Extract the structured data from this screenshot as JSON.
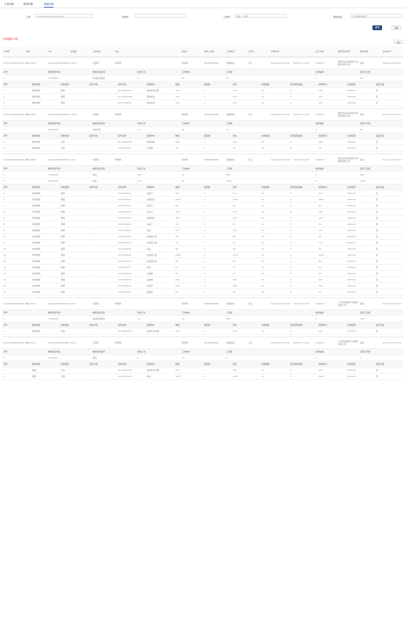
{
  "tabs": [
    {
      "label": "工单对账"
    },
    {
      "label": "费用对账"
    },
    {
      "label": "明细对账"
    }
  ],
  "filters": {
    "order_no_label": "工单",
    "order_no_value": "L20200801511020000003",
    "plate_label": "车牌号",
    "plate_value": "",
    "phone_label": "工单号",
    "phone_placeholder": "请输入工单号",
    "store_label": "服务网点",
    "store_placeholder": "请选择服务网点"
  },
  "buttons": {
    "search": "查询",
    "reset": "重置",
    "export": "导出"
  },
  "summary_text": "共有数据155条",
  "order_columns": [
    "工单号",
    "车牌",
    "VIN",
    "总里程",
    "工单状态",
    "车主",
    "",
    "",
    "送修人",
    "送修人电话",
    "工单来源",
    "接单人",
    "开单时间",
    "",
    "完工时间",
    "服务网点名称",
    "服务类型",
    "交车时间"
  ],
  "orders": [
    {
      "cells": [
        "R2110300001P0000",
        "豫A12345",
        "LSVAN4187N2000001",
        "15327",
        "已结算",
        "李师傅",
        "",
        "",
        "李师傅",
        "18569758888",
        "微信预约",
        "张三",
        "2021/10/30 23:06",
        "2022/1/7 12:00",
        "2022/1/7",
        "重庆市渝北区顺德汽车服务有限公司",
        "保养",
        "2022-01-07 09:51"
      ],
      "ticket_header": [
        "序号",
        "维修项目代码",
        "维修项目名称",
        "标准工时",
        "工时单价",
        "工时费",
        "",
        "优惠金额",
        "实际工时费"
      ],
      "tickets": [
        [
          "1",
          "71063000",
          "机油机滤更换",
          "6",
          "60",
          "90",
          "",
          "0",
          "90"
        ]
      ],
      "parts_header": [
        "序号",
        "维修类型",
        "收费类型",
        "配件代码",
        "配件名称",
        "结算单价",
        "数量",
        "结算额",
        "折扣",
        "优惠金额",
        "实际结算金额",
        "结算时间",
        "出库结算",
        "是否已结"
      ],
      "parts": [
        [
          "1",
          "保养维修",
          "质保",
          "-",
          "JP-L20200731",
          "发动机滤清器",
          "120",
          "1",
          "120",
          "10",
          "0",
          "120",
          "2022/01",
          "否"
        ],
        [
          "2",
          "保养维修",
          "质保",
          "-",
          "JP-L20201202",
          "发动机油",
          "120",
          "1",
          "120",
          "10",
          "0",
          "120",
          "2022/01",
          "否"
        ],
        [
          "3",
          "保养维修",
          "质保",
          "-",
          "S317230203",
          "机滤总成",
          "170",
          "1",
          "170",
          "10",
          "0",
          "170",
          "2022/01",
          "否"
        ]
      ]
    },
    {
      "cells": [
        "R2112190003P0000",
        "豫A67890",
        "LSVAN4187N2000002",
        "11000",
        "已结算",
        "李师傅",
        "",
        "",
        "李师傅",
        "18569758888",
        "微信预约",
        "张三",
        "2021/12/19 13:06",
        "2022/1/7 12:00",
        "2022/1/7",
        "重庆市渝北区顺德汽车服务有限公司",
        "保养",
        "2022-01-07 09:52"
      ],
      "ticket_header": [
        "序号",
        "维修项目代码",
        "维修项目名称",
        "标准工时",
        "工时单价",
        "工时费",
        "",
        "优惠金额",
        "实际工时费"
      ],
      "tickets": [
        [
          "1",
          "00000000",
          "全车检查",
          "0.7",
          "60",
          "60",
          "",
          "0",
          "60"
        ]
      ],
      "parts_header": [
        "序号",
        "维修类型",
        "收费类型",
        "配件代码",
        "配件名称",
        "结算单价",
        "数量",
        "结算额",
        "折扣",
        "优惠金额",
        "实际结算金额",
        "结算时间",
        "出库结算",
        "是否已结"
      ],
      "parts": [
        [
          "1",
          "保养维修",
          "正常",
          "-",
          "JP-L20200730",
          "前制动盘",
          "298",
          "1",
          "218",
          "10",
          "0",
          "218",
          "2022/01",
          "否"
        ],
        [
          "2",
          "保养维修",
          "正常",
          "-",
          "S317230212",
          "冷凝器",
          "26",
          "1",
          "18",
          "10",
          "0",
          "18",
          "2022/01",
          "否"
        ]
      ]
    },
    {
      "cells": [
        "R2110290001P0000",
        "豫A24680",
        "LSVAN4187N2000003",
        "3123",
        "已结算",
        "李师傅",
        "",
        "",
        "李师傅",
        "18569758888",
        "微信预约",
        "张三",
        "2021/10/29 23:06",
        "2022/1/7 12:00",
        "2022/1/7",
        "重庆市渝北区顺德汽车服务有限公司",
        "保养",
        "2021-10-29 10:10"
      ],
      "ticket_header": [
        "序号",
        "维修项目代码",
        "维修项目名称",
        "标准工时",
        "工时单价",
        "工时费",
        "",
        "优惠金额",
        "实际工时费"
      ],
      "tickets": [
        [
          "1",
          "71063000",
          "喷漆",
          "14.5",
          "60",
          "800",
          "",
          "0",
          "800"
        ],
        [
          "2",
          "24560000",
          "钣金",
          "21.7",
          "60",
          "1300",
          "",
          "0",
          "1300"
        ]
      ],
      "parts_header": [
        "序号",
        "维修类型",
        "收费类型",
        "配件代码",
        "配件名称",
        "结算单价",
        "数量",
        "结算额",
        "折扣",
        "优惠金额",
        "实际结算金额",
        "结算时间",
        "出库结算",
        "是否已结"
      ],
      "parts": [
        [
          "1",
          "喷漆维修",
          "质保",
          "-",
          "S317230215",
          "右前门",
          "117",
          "1",
          "117",
          "10",
          "0",
          "117",
          "2021/10",
          "否"
        ],
        [
          "2",
          "喷漆维修",
          "质保",
          "-",
          "S317230216",
          "后保险杠",
          "2000",
          "1",
          "2000",
          "10",
          "0",
          "2000",
          "2021/10",
          "否"
        ],
        [
          "3",
          "喷漆维修",
          "质保",
          "-",
          "S317230217",
          "左前门",
          "84",
          "1",
          "84",
          "10",
          "0",
          "84",
          "2021/10",
          "否"
        ],
        [
          "4",
          "喷漆维修",
          "质保",
          "-",
          "S317230218",
          "左后门",
          "130",
          "1",
          "130",
          "10",
          "0",
          "130",
          "2021/10",
          "否"
        ],
        [
          "5",
          "喷漆维修",
          "质保",
          "-",
          "S317230219",
          "前保险杠",
          "125",
          "1",
          "125",
          "10",
          "0",
          "125",
          "2021/10",
          "否"
        ],
        [
          "6",
          "喷漆维修",
          "质保",
          "-",
          "S317230220",
          "右后门",
          "79",
          "1",
          "79",
          "10",
          "0",
          "79",
          "2021/10",
          "否"
        ],
        [
          "7",
          "喷漆维修",
          "质保",
          "-",
          "S317230221",
          "机盖",
          "172",
          "1",
          "172",
          "10",
          "0",
          "172",
          "2021/10",
          "否"
        ],
        [
          "8",
          "喷漆维修",
          "质保",
          "-",
          "S317230222",
          "左前翼子板",
          "96",
          "1",
          "96",
          "10",
          "0",
          "96",
          "2021/10",
          "否"
        ],
        [
          "9",
          "喷漆维修",
          "质保",
          "-",
          "S317230223",
          "右前翼子板",
          "74",
          "1",
          "74",
          "10",
          "0",
          "74",
          "2021/10",
          "否"
        ],
        [
          "10",
          "喷漆维修",
          "质保",
          "-",
          "S317230224",
          "后盖",
          "99",
          "1",
          "99",
          "10",
          "0",
          "99",
          "2021/10",
          "否"
        ],
        [
          "11",
          "喷漆维修",
          "质保",
          "-",
          "S317230225",
          "左后翼子板",
          "1550",
          "1",
          "1550",
          "10",
          "0",
          "1550",
          "2021/10",
          "否"
        ],
        [
          "12",
          "喷漆维修",
          "质保",
          "-",
          "S317230226",
          "右后翼子板",
          "80",
          "1",
          "80",
          "10",
          "0",
          "80",
          "2021/10",
          "否"
        ],
        [
          "13",
          "喷漆维修",
          "质保",
          "-",
          "S317230227",
          "车顶",
          "87",
          "1",
          "87",
          "10",
          "0",
          "87",
          "2021/10",
          "否"
        ],
        [
          "14",
          "喷漆维修",
          "质保",
          "-",
          "S317230228",
          "左侧裙",
          "53",
          "1",
          "53",
          "10",
          "0",
          "53",
          "2021/10",
          "否"
        ],
        [
          "15",
          "喷漆维修",
          "质保",
          "-",
          "S317230229",
          "右侧裙",
          "220",
          "1",
          "220",
          "10",
          "0",
          "220",
          "2021/10",
          "否"
        ],
        [
          "16",
          "喷漆维修",
          "质保",
          "-",
          "S317230230",
          "后视镜",
          "530",
          "1",
          "530",
          "10",
          "0",
          "530",
          "2021/10",
          "否"
        ],
        [
          "17",
          "喷漆维修",
          "质保",
          "-",
          "S317230231",
          "油箱盖",
          "93",
          "1",
          "93",
          "10",
          "0",
          "93",
          "2021/10",
          "否"
        ]
      ]
    },
    {
      "cells": [
        "R2110300003P0000",
        "豫A13579",
        "LSVAN4187N2000004",
        "6327",
        "已结算",
        "李师傅",
        "",
        "",
        "李师傅",
        "18569758888",
        "微信预约",
        "张三",
        "2021/10/30 23:06",
        "2022/1/7 12:00",
        "2022/1/7",
        "广东深圳顺德汽车服务有限公司",
        "保养",
        "2021-10-30 10:20"
      ],
      "ticket_header": [
        "序号",
        "维修项目代码",
        "维修项目名称",
        "标准工时",
        "工时单价",
        "工时费",
        "",
        "优惠金额",
        "实际工时费"
      ],
      "tickets": [
        [
          "1",
          "71063000",
          "机油机滤更换",
          "4.1",
          "60",
          "165",
          "",
          "0",
          "165"
        ]
      ],
      "parts_header": [
        "序号",
        "维修类型",
        "收费类型",
        "配件代码",
        "配件名称",
        "结算单价",
        "数量",
        "结算额",
        "折扣",
        "优惠金额",
        "实际结算金额",
        "结算时间",
        "出库结算",
        "是否已结"
      ],
      "parts": [
        [
          "1",
          "保养维修",
          "质保",
          "-",
          "JP-L20200731",
          "发动机滤清器",
          "120",
          "1",
          "120",
          "10",
          "0",
          "120",
          "2021/10",
          "否"
        ]
      ]
    },
    {
      "cells": [
        "R2110300004P0000",
        "豫A97531",
        "LSVAN4187N2000005",
        "6218",
        "已结算",
        "李师傅",
        "",
        "",
        "李师傅",
        "18569758888",
        "微信预约",
        "张三",
        "2021/10/30 23:06",
        "2022/1/7 12:00",
        "2022/1/7",
        "广东深圳顺德汽车服务有限公司",
        "保养",
        "2021-10-30 10:30"
      ],
      "ticket_header": [
        "序号",
        "维修项目代码",
        "维修项目名称",
        "标准工时",
        "工时单价",
        "工时费",
        "",
        "优惠金额",
        "实际工时费"
      ],
      "tickets": [
        [
          "1",
          "71063001",
          "首保",
          "6",
          "74",
          "0",
          "",
          "0",
          "0"
        ]
      ],
      "parts_header": [
        "序号",
        "维修类型",
        "收费类型",
        "配件代码",
        "配件名称",
        "结算单价",
        "数量",
        "结算额",
        "折扣",
        "优惠金额",
        "实际结算金额",
        "结算时间",
        "出库结算",
        "是否已结"
      ],
      "parts": [
        [
          "1",
          "首保",
          "正常",
          "-",
          "JP-L20200731",
          "发动机滤清器",
          "255",
          "1",
          "255",
          "10",
          "0",
          "255",
          "2021/10",
          "否"
        ],
        [
          "2",
          "首保",
          "正常",
          "-",
          "S317230203",
          "机油",
          "1230",
          "1",
          "1230",
          "10",
          "0",
          "1230",
          "2021/10",
          "否"
        ]
      ]
    }
  ]
}
